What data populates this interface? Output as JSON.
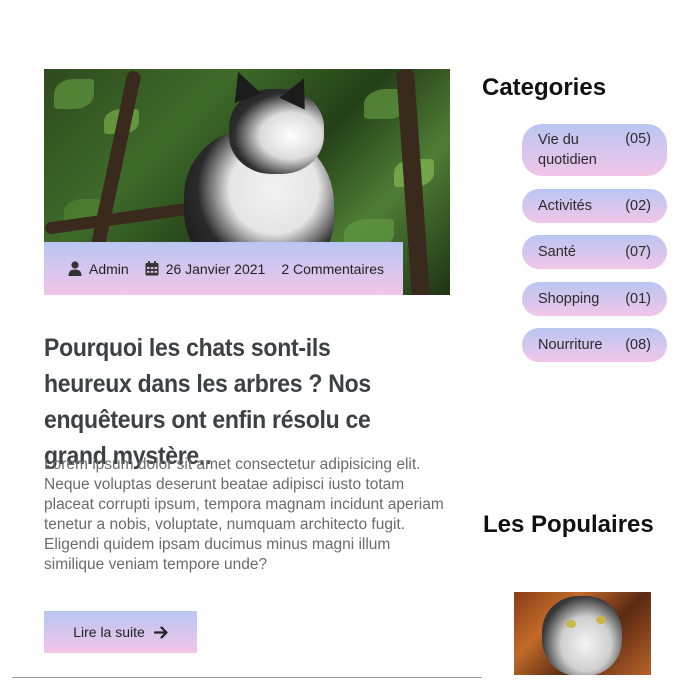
{
  "post": {
    "author": "Admin",
    "date": "26 Janvier 2021",
    "comments": "2 Commentaires",
    "title": "Pourquoi les chats sont-ils heureux dans les arbres ? Nos enquêteurs ont enfin résolu ce grand mystère..",
    "excerpt": "Lorem ipsum dolor sit amet consectetur adipisicing elit. Neque voluptas deserunt beatae adipisci iusto totam placeat corrupti ipsum, tempora magnam incidunt aperiam tenetur a nobis, voluptate, numquam architecto fugit. Eligendi quidem ipsam ducimus minus magni illum similique veniam tempore unde?",
    "read_more_label": "Lire la suite"
  },
  "sidebar": {
    "categories_heading": "Categories",
    "categories": [
      {
        "name": "Vie du quotidien",
        "count": "(05)"
      },
      {
        "name": "Activités",
        "count": "(02)"
      },
      {
        "name": "Santé",
        "count": "(07)"
      },
      {
        "name": "Shopping",
        "count": "(01)"
      },
      {
        "name": "Nourriture",
        "count": "(08)"
      }
    ],
    "popular_heading": "Les Populaires"
  },
  "icons": {
    "author": "user-icon",
    "date": "calendar-icon",
    "read_more": "arrow-right-icon"
  },
  "colors": {
    "gradient_top": "#b8c6f2",
    "gradient_bottom": "#f3c5e9",
    "title": "#3e4046",
    "excerpt": "#6b6b6b"
  }
}
